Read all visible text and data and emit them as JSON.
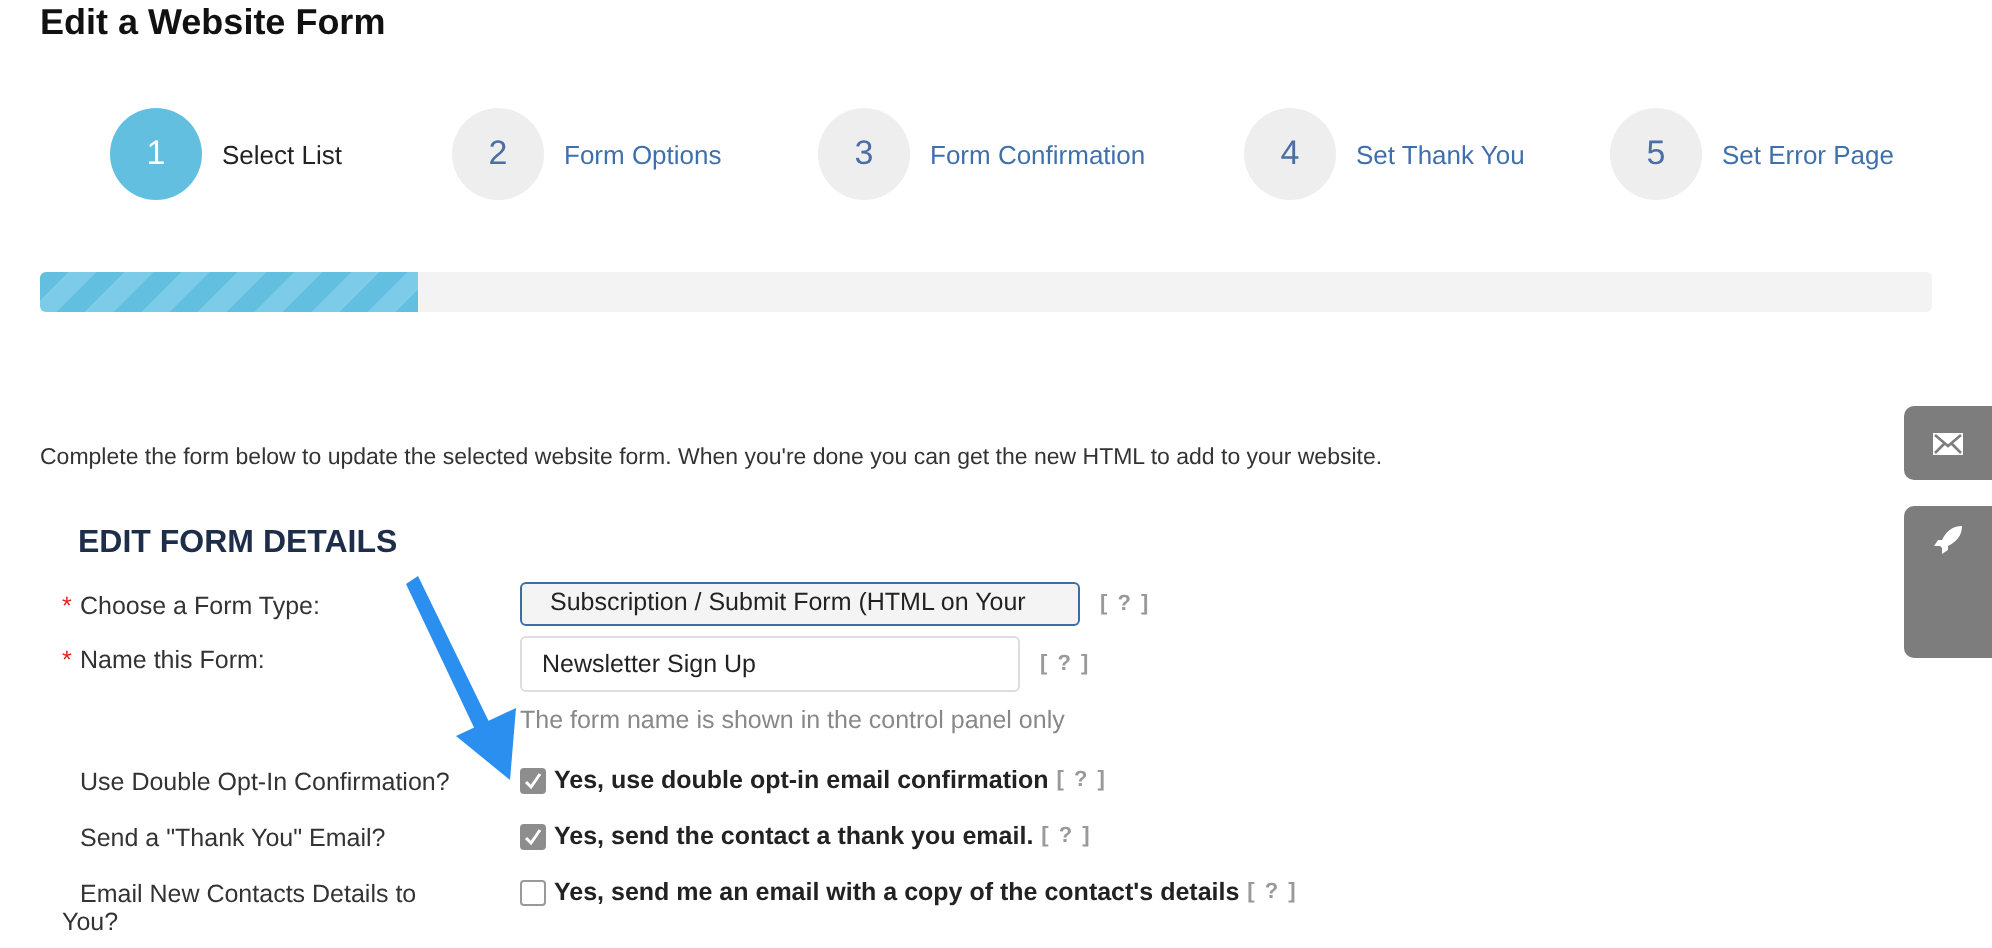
{
  "title": "Edit a Website Form",
  "steps": [
    {
      "number": "1",
      "label": "Select List",
      "selected": true
    },
    {
      "number": "2",
      "label": "Form Options",
      "selected": false
    },
    {
      "number": "3",
      "label": "Form Confirmation",
      "selected": false
    },
    {
      "number": "4",
      "label": "Set Thank You",
      "selected": false
    },
    {
      "number": "5",
      "label": "Set Error Page",
      "selected": false
    }
  ],
  "progress": {
    "level": 0.2
  },
  "intro": "Complete the form below to update the selected website form. When you're done you can get the new HTML to add to your website.",
  "section_heading": "EDIT FORM DETAILS",
  "rows": [
    {
      "kind": "select",
      "required_mark": "*",
      "label": "Choose a Form Type:",
      "value": "Subscription / Submit Form (HTML on Your",
      "help": "[ ? ]"
    },
    {
      "kind": "text",
      "required_mark": "*",
      "label": "Name this Form:",
      "value": "Newsletter Sign Up",
      "help": "[ ? ]",
      "hint": "The form name is shown in the control panel only"
    },
    {
      "kind": "checkbox",
      "label": "Use Double Opt-In Confirmation?",
      "checked": true,
      "option": "Yes, use double opt-in email confirmation",
      "help": "[ ? ]"
    },
    {
      "kind": "checkbox",
      "label": "Send a \"Thank You\" Email?",
      "checked": true,
      "option": "Yes, send the contact a thank you email.",
      "help": "[ ? ]"
    },
    {
      "kind": "checkbox",
      "label": "Email New Contacts Details to You?",
      "checked": false,
      "option": "Yes, send me an email with a copy of the contact's details",
      "help": "[ ? ]"
    }
  ]
}
